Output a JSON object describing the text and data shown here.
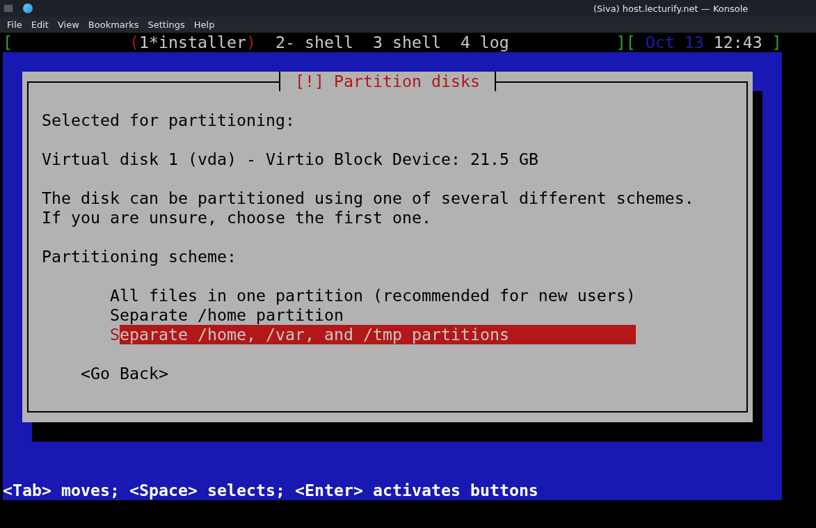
{
  "window": {
    "title": "(Siva) host.lecturify.net — Konsole"
  },
  "menu": [
    "File",
    "Edit",
    "View",
    "Bookmarks",
    "Settings",
    "Help"
  ],
  "status_line": {
    "brackets": [
      "[",
      "][",
      "]"
    ],
    "selection_marks": [
      "(",
      ")"
    ],
    "windows": [
      {
        "label": "1*installer",
        "selected": true
      },
      {
        "label": "2- shell",
        "selected": false
      },
      {
        "label": "3 shell",
        "selected": false
      },
      {
        "label": "4 log",
        "selected": false
      }
    ],
    "date": "Oct 13",
    "time": "12:43"
  },
  "dialog": {
    "title": "[!] Partition disks",
    "selected_label": "Selected for partitioning:",
    "disk": "Virtual disk 1 (vda) - Virtio Block Device: 21.5 GB",
    "description": [
      "The disk can be partitioned using one of several different schemes.",
      "If you are unsure, choose the first one."
    ],
    "scheme_label": "Partitioning scheme:",
    "options": [
      {
        "label": "All files in one partition (recommended for new users)",
        "selected": false
      },
      {
        "label": "Separate /home partition",
        "selected": false
      },
      {
        "label": "Separate /home, /var, and /tmp partitions",
        "selected": true
      }
    ],
    "back_button": "<Go Back>"
  },
  "help_line": "<Tab> moves; <Space> selects; <Enter> activates buttons"
}
